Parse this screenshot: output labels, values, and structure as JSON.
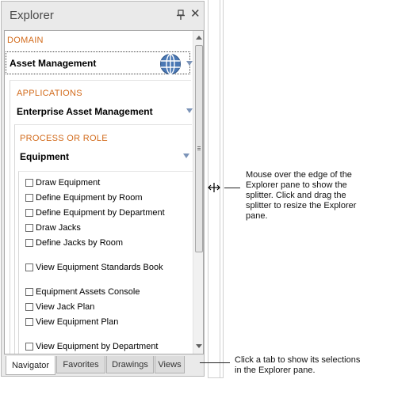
{
  "explorer": {
    "title": "Explorer",
    "pin_icon": "pin-icon",
    "close_icon": "close-icon",
    "close_glyph": "✕"
  },
  "domain": {
    "label": "DOMAIN",
    "value": "Asset Management",
    "icon": "globe-icon"
  },
  "applications": {
    "label": "APPLICATIONS",
    "value": "Enterprise Asset Management"
  },
  "process": {
    "label": "PROCESS OR ROLE",
    "value": "Equipment"
  },
  "tasks": [
    "Draw Equipment",
    "Define Equipment by Room",
    "Define Equipment by Department",
    "Draw Jacks",
    "Define Jacks by Room",
    "View Equipment Standards Book",
    "Equipment Assets Console",
    "View Jack Plan",
    "View Equipment Plan",
    "View Equipment by Department"
  ],
  "tabs": [
    {
      "label": "Navigator",
      "active": true
    },
    {
      "label": "Favorites",
      "active": false
    },
    {
      "label": "Drawings",
      "active": false
    },
    {
      "label": "Views",
      "active": false
    }
  ],
  "notes": {
    "splitter": [
      "Mouse over the edge of the",
      "Explorer pane to show the",
      "splitter. Click and drag the",
      "splitter to resize the Explorer",
      "pane."
    ],
    "tabs": [
      "Click a tab to show its selections",
      "in the Explorer pane."
    ]
  },
  "colors": {
    "section_label": "#d26a1a",
    "dropdown_arrow": "#7c94b8"
  }
}
